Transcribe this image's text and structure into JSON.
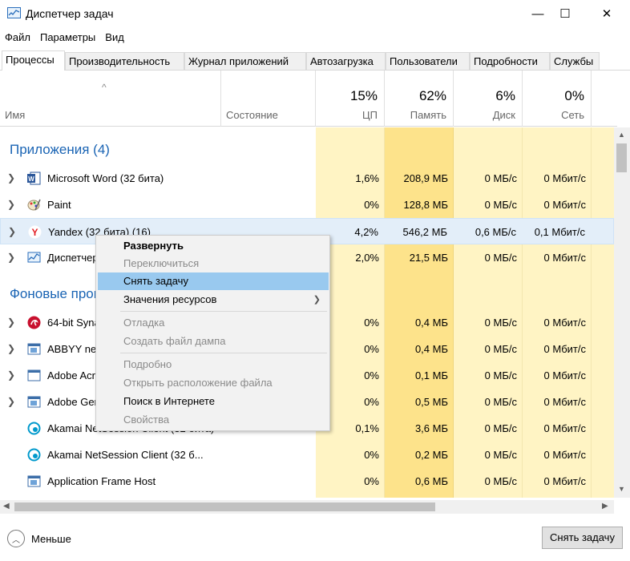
{
  "window": {
    "title": "Диспетчер задач",
    "minimize": "—",
    "maximize": "☐",
    "close": "✕"
  },
  "menu": [
    "Файл",
    "Параметры",
    "Вид"
  ],
  "tabs": [
    "Процессы",
    "Производительность",
    "Журнал приложений",
    "Автозагрузка",
    "Пользователи",
    "Подробности",
    "Службы"
  ],
  "columns": {
    "name": "Имя",
    "status": "Состояние",
    "cpu": {
      "pct": "15%",
      "label": "ЦП"
    },
    "memory": {
      "pct": "62%",
      "label": "Память"
    },
    "disk": {
      "pct": "6%",
      "label": "Диск"
    },
    "network": {
      "pct": "0%",
      "label": "Сеть"
    }
  },
  "groups": {
    "apps": "Приложения (4)",
    "background": "Фоновые процессы (49)"
  },
  "rows": [
    {
      "name": "Microsoft Word (32 бита)",
      "cpu": "1,6%",
      "mem": "208,9 МБ",
      "disk": "0 МБ/с",
      "net": "0 Мбит/с"
    },
    {
      "name": "Paint",
      "cpu": "0%",
      "mem": "128,8 МБ",
      "disk": "0 МБ/с",
      "net": "0 Мбит/с"
    },
    {
      "name": "Yandex (32 бита) (16)",
      "cpu": "4,2%",
      "mem": "546,2 МБ",
      "disk": "0,6 МБ/с",
      "net": "0,1 Мбит/с"
    },
    {
      "name": "Диспетчер задач",
      "cpu": "2,0%",
      "mem": "21,5 МБ",
      "disk": "0 МБ/с",
      "net": "0 Мбит/с"
    },
    {
      "name": "64-bit Synaptics Pointing Enhance Service",
      "cpu": "0%",
      "mem": "0,4 МБ",
      "disk": "0 МБ/с",
      "net": "0 Мбит/с"
    },
    {
      "name": "ABBYY network license server",
      "cpu": "0%",
      "mem": "0,4 МБ",
      "disk": "0 МБ/с",
      "net": "0 Мбит/с"
    },
    {
      "name": "Adobe Acrobat Update Service",
      "cpu": "0%",
      "mem": "0,1 МБ",
      "disk": "0 МБ/с",
      "net": "0 Мбит/с"
    },
    {
      "name": "Adobe Genuine Software Service",
      "cpu": "0%",
      "mem": "0,5 МБ",
      "disk": "0 МБ/с",
      "net": "0 Мбит/с"
    },
    {
      "name": "Akamai NetSession Client (32 бита)",
      "cpu": "0,1%",
      "mem": "3,6 МБ",
      "disk": "0 МБ/с",
      "net": "0 Мбит/с"
    },
    {
      "name": "Akamai NetSession Client (32 б...",
      "cpu": "0%",
      "mem": "0,2 МБ",
      "disk": "0 МБ/с",
      "net": "0 Мбит/с"
    },
    {
      "name": "Application Frame Host",
      "cpu": "0%",
      "mem": "0,6 МБ",
      "disk": "0 МБ/с",
      "net": "0 Мбит/с"
    }
  ],
  "context_menu": {
    "expand": "Развернуть",
    "switch_to": "Переключиться",
    "end_task": "Снять задачу",
    "resource_values": "Значения ресурсов",
    "debug": "Отладка",
    "create_dump": "Создать файл дампа",
    "details": "Подробно",
    "open_location": "Открыть расположение файла",
    "search_online": "Поиск в Интернете",
    "properties": "Свойства"
  },
  "footer": {
    "less": "Меньше",
    "end_task_button": "Снять задачу"
  },
  "colors": {
    "accent": "#1a64b4",
    "cpu_heat": "#fff4c4",
    "mem_heat": "#fde38b",
    "row_highlight": "#e3eef9",
    "menu_hover": "#99c9ef"
  }
}
